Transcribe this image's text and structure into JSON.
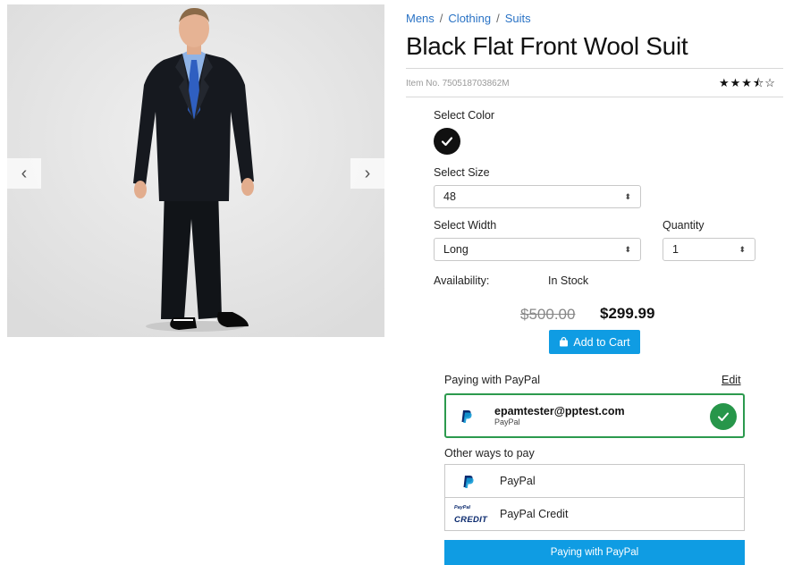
{
  "gallery": {
    "prev_icon": "chevron-left-icon",
    "next_icon": "chevron-right-icon",
    "prev_glyph": "‹",
    "next_glyph": "›",
    "slide_count": 2,
    "active_slide": 1
  },
  "breadcrumb": {
    "items": [
      "Mens",
      "Clothing",
      "Suits"
    ],
    "separator": "/"
  },
  "product": {
    "title": "Black Flat Front Wool Suit",
    "item_no": "Item No. 750518703862M",
    "rating": 3.5,
    "rating_max": 5,
    "stars_text": "★★★⯪☆"
  },
  "options": {
    "color_label": "Select Color",
    "selected_color": "#111111",
    "size_label": "Select Size",
    "size_value": "48",
    "width_label": "Select Width",
    "width_value": "Long",
    "quantity_label": "Quantity",
    "quantity_value": "1",
    "select_arrow": "⬍"
  },
  "availability": {
    "label": "Availability:",
    "value": "In Stock"
  },
  "pricing": {
    "old_price": "$500.00",
    "new_price": "$299.99",
    "add_to_cart": "Add to Cart"
  },
  "payment": {
    "heading": "Paying with PayPal",
    "edit": "Edit",
    "account_email": "epamtester@pptest.com",
    "account_method": "PayPal",
    "other_heading": "Other ways to pay",
    "options": [
      "PayPal",
      "PayPal Credit"
    ],
    "credit_logo_small": "PayPal",
    "credit_logo_big": "CREDIT",
    "submit": "Paying with PayPal"
  },
  "colors": {
    "accent": "#0f9ce3",
    "link": "#2a73c5",
    "success": "#27964a",
    "paypal_dark": "#0b2a6e",
    "paypal_light": "#139ad6"
  }
}
